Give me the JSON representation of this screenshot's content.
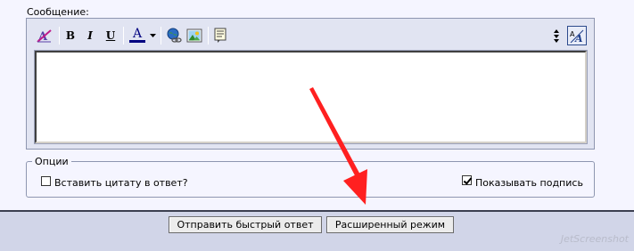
{
  "message": {
    "label": "Сообщение:",
    "text_value": ""
  },
  "toolbar": {
    "icons": [
      "remove-format-icon",
      "bold-icon",
      "italic-icon",
      "underline-icon",
      "font-color-icon",
      "insert-link-icon",
      "insert-image-icon",
      "insert-quote-icon",
      "resize-icon",
      "switch-editor-mode-icon"
    ],
    "bold": "B",
    "italic": "I",
    "underline": "U",
    "font_color_letter": "A",
    "font_color_value": "#000080"
  },
  "options": {
    "legend": "Опции",
    "insert_quote_label": "Вставить цитату в ответ?",
    "insert_quote_checked": false,
    "show_signature_label": "Показывать подпись",
    "show_signature_checked": true
  },
  "buttons": {
    "quick_reply": "Отправить быстрый ответ",
    "advanced_mode": "Расширенный режим"
  },
  "colors": {
    "form_background": "#f5f5ff",
    "editor_background": "#e1e4f2",
    "bottom_bar": "#d1d5e8",
    "annotation_arrow": "#ff2020"
  },
  "watermark": "JetScreenshot"
}
